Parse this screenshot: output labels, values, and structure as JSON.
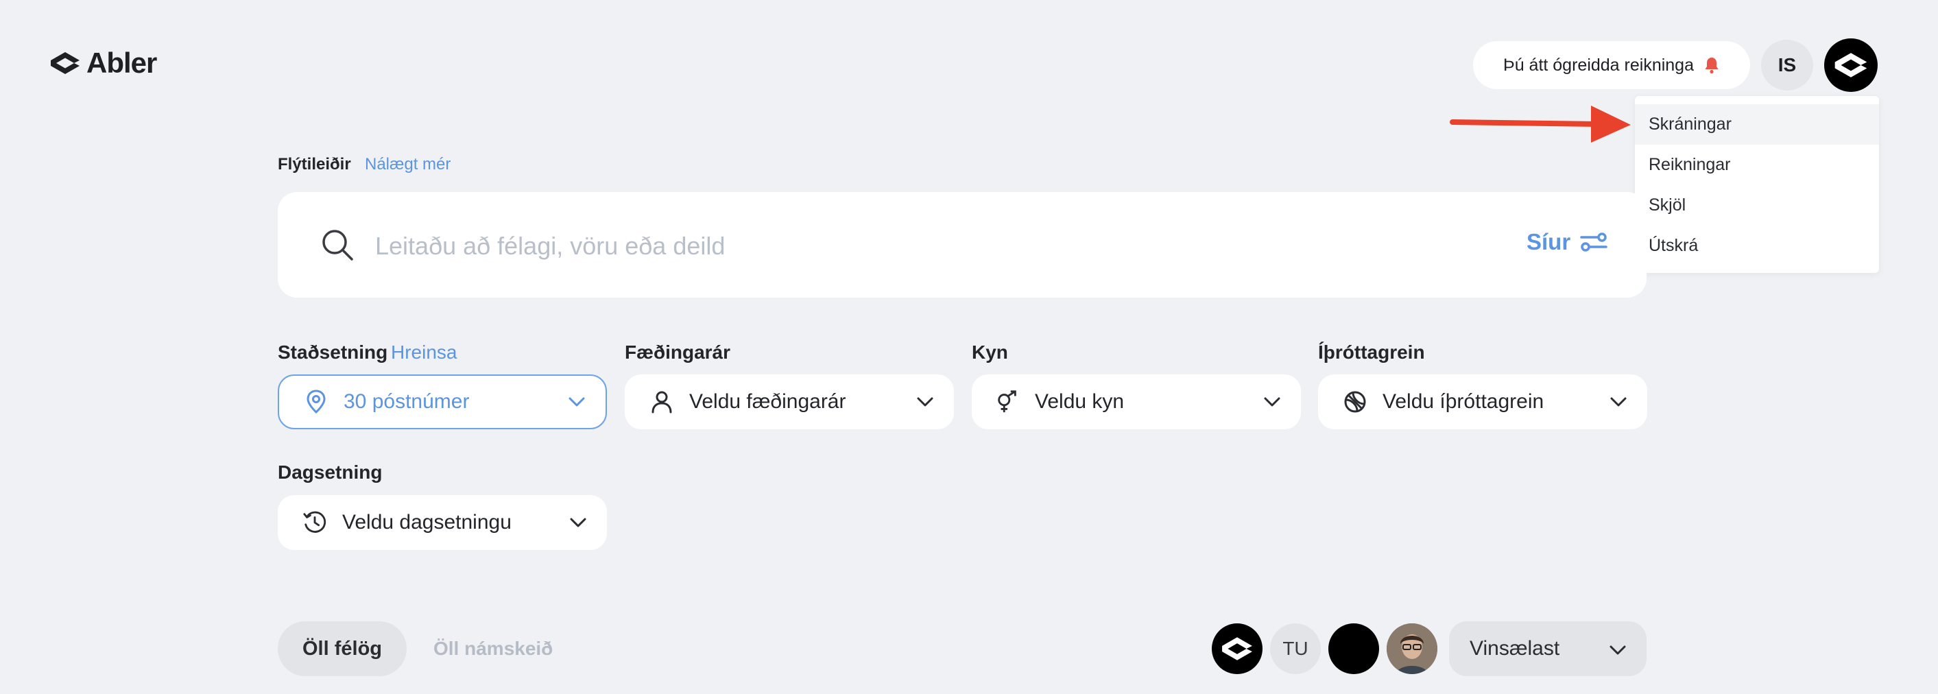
{
  "brand": {
    "name": "Abler"
  },
  "header": {
    "bill_notice": "Þú átt ógreidda reikninga",
    "language": "IS"
  },
  "account_menu": {
    "items": [
      "Skráningar",
      "Reikningar",
      "Skjöl",
      "Útskrá"
    ],
    "active_index": 0
  },
  "quick": {
    "label": "Flýtileiðir",
    "link": "Nálægt mér"
  },
  "search": {
    "placeholder": "Leitaðu að félagi, vöru eða deild",
    "filters_label": "Síur"
  },
  "filters": {
    "location": {
      "label": "Staðsetning",
      "clear": "Hreinsa",
      "value": "30 póstnúmer"
    },
    "birth_year": {
      "label": "Fæðingarár",
      "value": "Veldu fæðingarár"
    },
    "gender": {
      "label": "Kyn",
      "value": "Veldu kyn"
    },
    "sport": {
      "label": "Íþróttagrein",
      "value": "Veldu íþróttagrein"
    },
    "date": {
      "label": "Dagsetning",
      "value": "Veldu dagsetningu"
    }
  },
  "bottom": {
    "tab_clubs": "Öll félög",
    "tab_courses": "Öll námskeið",
    "avatar_initials": "TU",
    "sort_value": "Vinsælast"
  },
  "colors": {
    "accent": "#5b94e0",
    "annotation_arrow": "#e8412c",
    "bell": "#e8564a",
    "background": "#eff1f4"
  }
}
